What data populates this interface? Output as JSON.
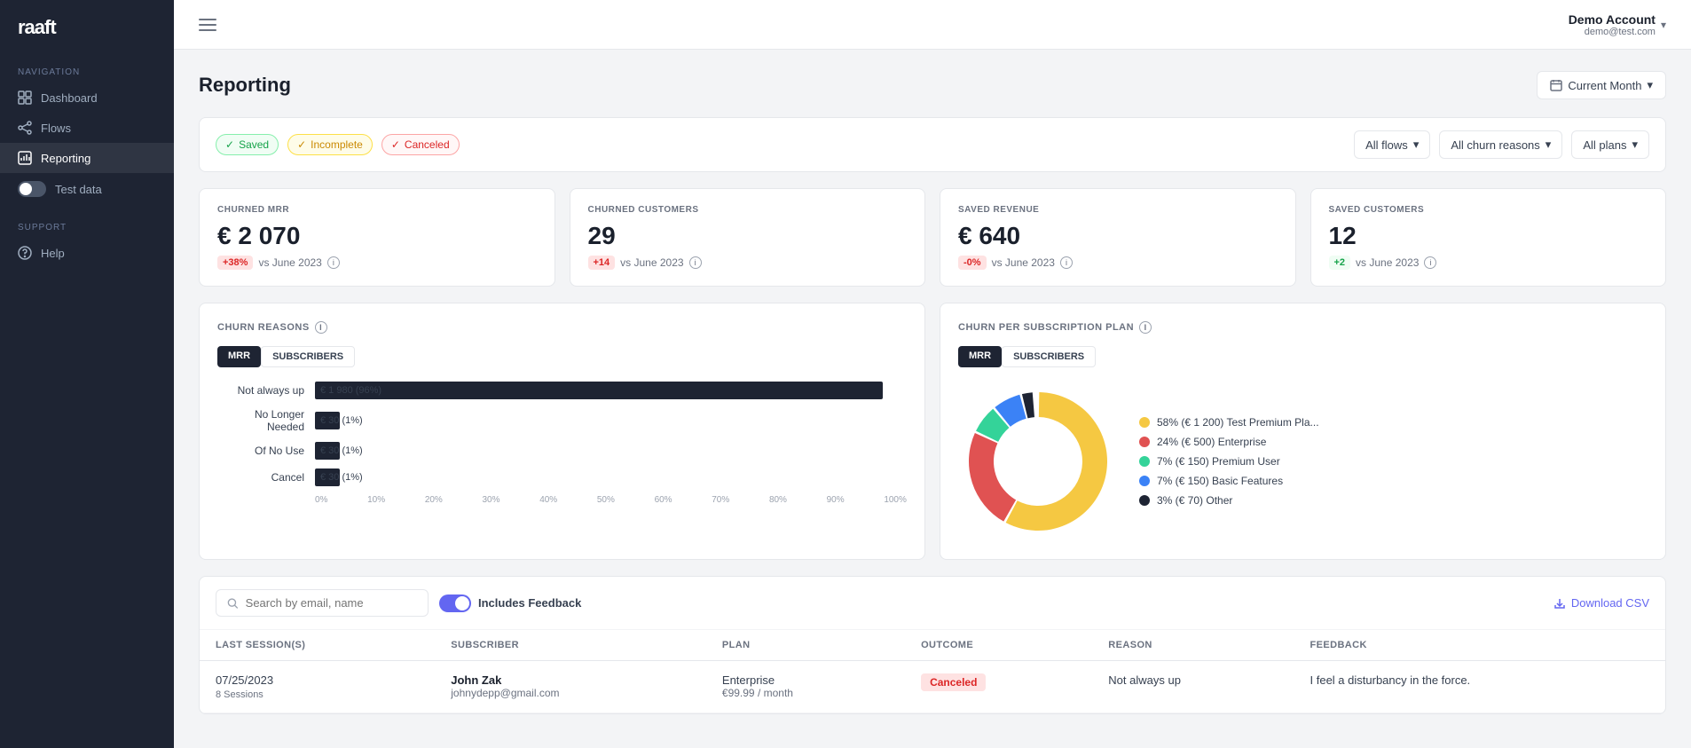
{
  "sidebar": {
    "logo": "raaft",
    "nav_label": "NAVIGATION",
    "nav_items": [
      {
        "id": "dashboard",
        "label": "Dashboard",
        "icon": "grid"
      },
      {
        "id": "flows",
        "label": "Flows",
        "icon": "flows"
      },
      {
        "id": "reporting",
        "label": "Reporting",
        "icon": "reporting",
        "active": true
      },
      {
        "id": "test-data",
        "label": "Test data",
        "icon": "toggle"
      }
    ],
    "support_label": "SUPPORT",
    "support_items": [
      {
        "id": "help",
        "label": "Help",
        "icon": "help"
      }
    ]
  },
  "header": {
    "account_name": "Demo Account",
    "account_email": "demo@test.com"
  },
  "page": {
    "title": "Reporting",
    "date_filter": "Current Month"
  },
  "filters": {
    "badges": [
      {
        "id": "saved",
        "label": "Saved",
        "type": "saved"
      },
      {
        "id": "incomplete",
        "label": "Incomplete",
        "type": "incomplete"
      },
      {
        "id": "canceled",
        "label": "Canceled",
        "type": "canceled"
      }
    ],
    "dropdowns": [
      {
        "id": "flows",
        "label": "All flows"
      },
      {
        "id": "churn_reasons",
        "label": "All churn reasons"
      },
      {
        "id": "plans",
        "label": "All plans"
      }
    ]
  },
  "metrics": [
    {
      "id": "churned-mrr",
      "label": "CHURNED MRR",
      "value": "€ 2 070",
      "badge": "+38%",
      "badge_type": "up",
      "sub": "vs June 2023"
    },
    {
      "id": "churned-customers",
      "label": "CHURNED CUSTOMERS",
      "value": "29",
      "badge": "+14",
      "badge_type": "up",
      "sub": "vs June 2023"
    },
    {
      "id": "saved-revenue",
      "label": "SAVED REVENUE",
      "value": "€ 640",
      "badge": "-0%",
      "badge_type": "neutral",
      "sub": "vs June 2023"
    },
    {
      "id": "saved-customers",
      "label": "SAVED CUSTOMERS",
      "value": "12",
      "badge": "+2",
      "badge_type": "pos",
      "sub": "vs June 2023"
    }
  ],
  "churn_reasons": {
    "title": "CHURN REASONS",
    "tabs": [
      "MRR",
      "SUBSCRIBERS"
    ],
    "active_tab": "MRR",
    "bars": [
      {
        "label": "Not always up",
        "value": "€ 1 980 (96%)",
        "pct": 96,
        "color": "#1e2433"
      },
      {
        "label": "No Longer Needed",
        "value": "€ 30 (1%)",
        "pct": 2,
        "color": "#1e2433"
      },
      {
        "label": "Of No Use",
        "value": "€ 30 (1%)",
        "pct": 2,
        "color": "#1e2433"
      },
      {
        "label": "Cancel",
        "value": "€ 30 (1%)",
        "pct": 2,
        "color": "#1e2433"
      }
    ],
    "axis_labels": [
      "0%",
      "10%",
      "20%",
      "30%",
      "40%",
      "50%",
      "60%",
      "70%",
      "80%",
      "90%",
      "100%"
    ]
  },
  "churn_per_plan": {
    "title": "CHURN PER SUBSCRIPTION PLAN",
    "tabs": [
      "MRR",
      "SUBSCRIBERS"
    ],
    "active_tab": "MRR",
    "segments": [
      {
        "label": "58% (€ 1 200) Test Premium Pla...",
        "pct": 58,
        "color": "#f5c842",
        "startAngle": 0
      },
      {
        "label": "24% (€ 500) Enterprise",
        "pct": 24,
        "color": "#e05252",
        "startAngle": 209
      },
      {
        "label": "7% (€ 150) Premium User",
        "pct": 7,
        "color": "#34d399",
        "startAngle": 296
      },
      {
        "label": "7% (€ 150) Basic Features",
        "pct": 7,
        "color": "#3b82f6",
        "startAngle": 321
      },
      {
        "label": "3% (€ 70) Other",
        "pct": 3,
        "color": "#1e2433",
        "startAngle": 346
      }
    ]
  },
  "table": {
    "search_placeholder": "Search by email, name",
    "toggle_label": "Includes Feedback",
    "download_label": "Download CSV",
    "columns": [
      "Last Session(s)",
      "Subscriber",
      "Plan",
      "Outcome",
      "Reason",
      "Feedback"
    ],
    "rows": [
      {
        "date": "07/25/2023",
        "sessions": "8 Sessions",
        "name": "John Zak",
        "email": "johnydepp@gmail.com",
        "plan": "Enterprise",
        "price": "€99.99 / month",
        "outcome": "Canceled",
        "reason": "Not always up",
        "feedback": "I feel a disturbancy in the force."
      }
    ]
  }
}
